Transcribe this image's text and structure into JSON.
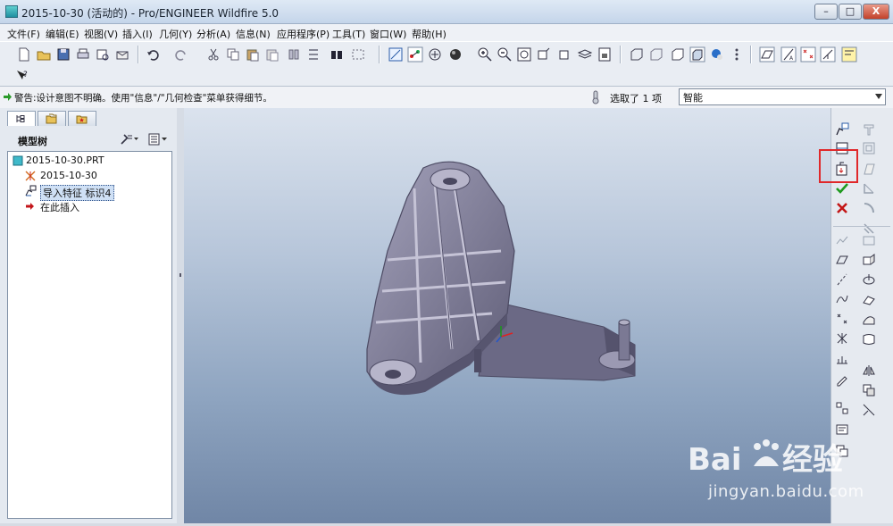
{
  "window": {
    "title": "2015-10-30 (活动的) - Pro/ENGINEER Wildfire 5.0",
    "minimize_label": "–",
    "maximize_label": "□",
    "close_label": "X"
  },
  "menu": {
    "items": [
      "文件(F)",
      "编辑(E)",
      "视图(V)",
      "插入(I)",
      "几何(Y)",
      "分析(A)",
      "信息(N)",
      "应用程序(P)",
      "工具(T)",
      "窗口(W)",
      "帮助(H)"
    ]
  },
  "toolbar2": {
    "whats_this_icon": "what's-this-icon"
  },
  "message_bar": {
    "message": "警告:设计意图不明确。使用\"信息\"/\"几何检查\"菜单获得细节。",
    "selection_status": "选取了 1 项",
    "filter_value": "智能"
  },
  "left_panel": {
    "tree_title": "模型树",
    "tree": [
      {
        "label": "2015-10-30.PRT",
        "icon": "part-icon"
      },
      {
        "label": "2015-10-30",
        "icon": "coordinate-system-icon"
      },
      {
        "label": "导入特征 标识4",
        "icon": "import-feature-icon"
      },
      {
        "label": "在此插入",
        "icon": "insert-here-arrow-icon"
      }
    ]
  },
  "colors": {
    "viewport_top": "#dbe3ee",
    "viewport_bottom": "#7086a6",
    "model": "#8c8aa3",
    "highlight": "#e0282a"
  },
  "watermark": {
    "url": "jingyan.baidu.com"
  }
}
